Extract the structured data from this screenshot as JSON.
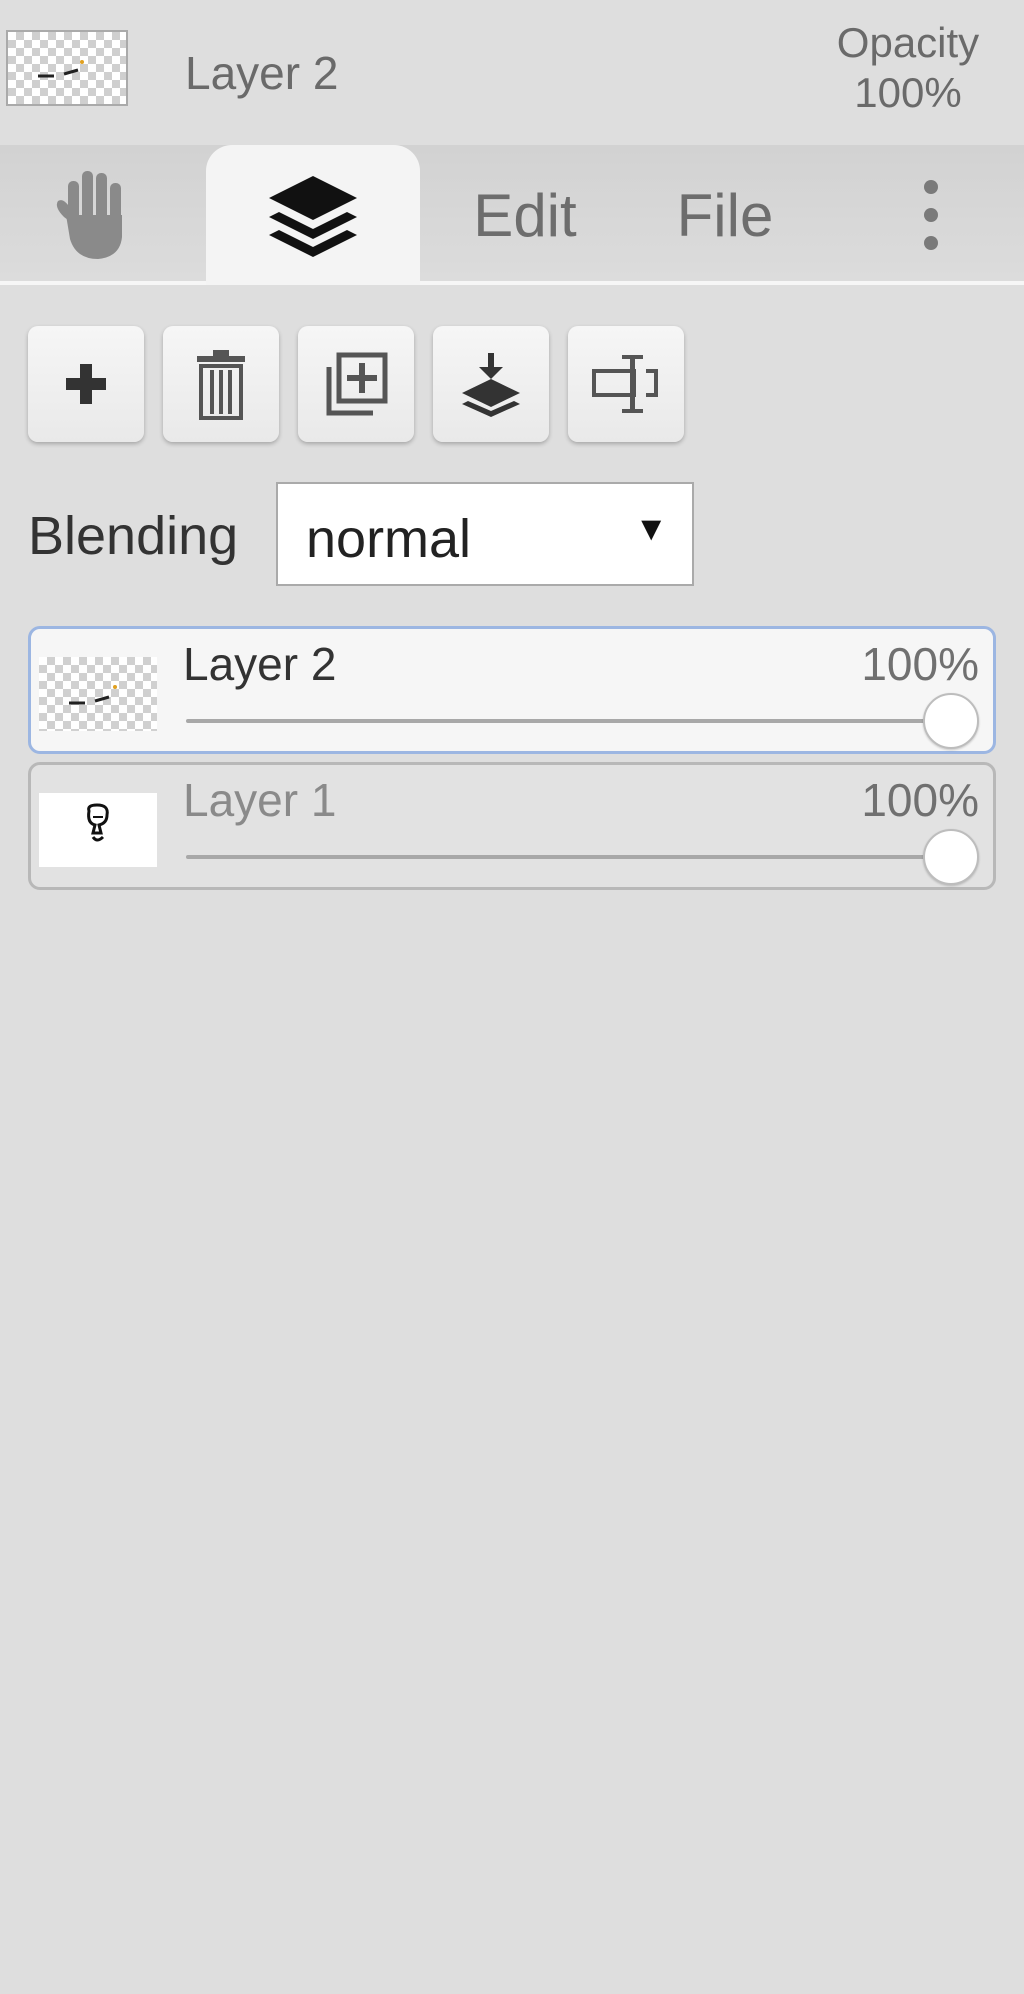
{
  "header": {
    "layer_name": "Layer 2",
    "opacity_label": "Opacity",
    "opacity_value": "100%"
  },
  "tabs": [
    {
      "id": "hand",
      "icon": "hand-icon",
      "label": ""
    },
    {
      "id": "layers",
      "icon": "layers-icon",
      "label": "",
      "active": true
    },
    {
      "id": "edit",
      "label": "Edit"
    },
    {
      "id": "file",
      "label": "File"
    },
    {
      "id": "more",
      "icon": "more-vertical-icon",
      "label": ""
    }
  ],
  "toolbar": {
    "buttons": [
      {
        "icon": "add-layer-icon"
      },
      {
        "icon": "delete-layer-icon"
      },
      {
        "icon": "duplicate-layer-icon"
      },
      {
        "icon": "merge-down-icon"
      },
      {
        "icon": "rename-layer-icon"
      }
    ]
  },
  "blending": {
    "label": "Blending",
    "value": "normal"
  },
  "layers": [
    {
      "name": "Layer 2",
      "opacity": "100%",
      "opacity_fraction": 1.0,
      "selected": true
    },
    {
      "name": "Layer 1",
      "opacity": "100%",
      "opacity_fraction": 1.0,
      "selected": false
    }
  ],
  "colors": {
    "background": "#dedede",
    "selected_border": "#9cb6e2",
    "active_tab": "#f4f4f4"
  }
}
